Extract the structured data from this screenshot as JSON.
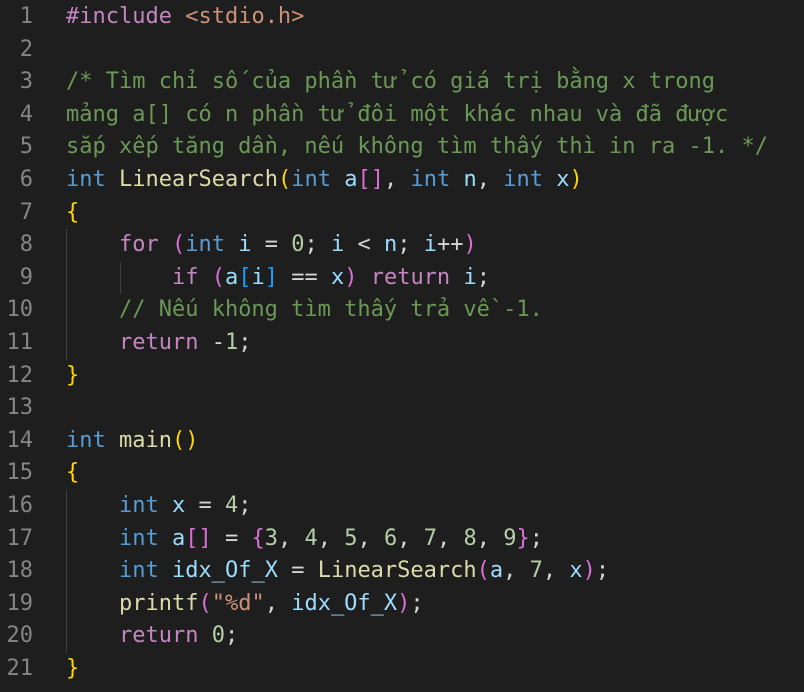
{
  "colors": {
    "background": "#1e1e1e",
    "line_number": "#858585",
    "default": "#d4d4d4",
    "keyword_control": "#c586c0",
    "keyword_type": "#569cd6",
    "function": "#dcdcaa",
    "variable": "#9cdcfe",
    "number": "#b5cea8",
    "string": "#ce9178",
    "comment": "#6a9955",
    "bracket_gold": "#ffd700",
    "bracket_pink": "#da70d6",
    "bracket_blue": "#179fff"
  },
  "editor": {
    "lines": [
      {
        "n": "1",
        "tokens": [
          [
            "#include ",
            "keyword_control"
          ],
          [
            "<stdio.h>",
            "string"
          ]
        ]
      },
      {
        "n": "2",
        "tokens": []
      },
      {
        "n": "3",
        "tokens": [
          [
            "/* Tìm chỉ số của phần tử có giá trị bằng x trong",
            "comment"
          ]
        ]
      },
      {
        "n": "4",
        "tokens": [
          [
            "mảng a[] có n phần tử đôi một khác nhau và đã được",
            "comment"
          ]
        ]
      },
      {
        "n": "5",
        "tokens": [
          [
            "sắp xếp tăng dần, nếu không tìm thấy thì in ra -1. */",
            "comment"
          ]
        ]
      },
      {
        "n": "6",
        "tokens": [
          [
            "int",
            "keyword_type"
          ],
          [
            " ",
            "default"
          ],
          [
            "LinearSearch",
            "function"
          ],
          [
            "(",
            "bracket_gold"
          ],
          [
            "int",
            "keyword_type"
          ],
          [
            " ",
            "default"
          ],
          [
            "a",
            "variable"
          ],
          [
            "[]",
            "bracket_pink"
          ],
          [
            ", ",
            "default"
          ],
          [
            "int",
            "keyword_type"
          ],
          [
            " ",
            "default"
          ],
          [
            "n",
            "variable"
          ],
          [
            ", ",
            "default"
          ],
          [
            "int",
            "keyword_type"
          ],
          [
            " ",
            "default"
          ],
          [
            "x",
            "variable"
          ],
          [
            ")",
            "bracket_gold"
          ]
        ]
      },
      {
        "n": "7",
        "tokens": [
          [
            "{",
            "bracket_gold"
          ]
        ]
      },
      {
        "n": "8",
        "tokens": [
          [
            "    ",
            "default"
          ],
          [
            "for",
            "keyword_control"
          ],
          [
            " ",
            "default"
          ],
          [
            "(",
            "bracket_pink"
          ],
          [
            "int",
            "keyword_type"
          ],
          [
            " ",
            "default"
          ],
          [
            "i",
            "variable"
          ],
          [
            " = ",
            "default"
          ],
          [
            "0",
            "number"
          ],
          [
            "; ",
            "default"
          ],
          [
            "i",
            "variable"
          ],
          [
            " < ",
            "default"
          ],
          [
            "n",
            "variable"
          ],
          [
            "; ",
            "default"
          ],
          [
            "i",
            "variable"
          ],
          [
            "++",
            "default"
          ],
          [
            ")",
            "bracket_pink"
          ]
        ]
      },
      {
        "n": "9",
        "tokens": [
          [
            "        ",
            "default"
          ],
          [
            "if",
            "keyword_control"
          ],
          [
            " ",
            "default"
          ],
          [
            "(",
            "bracket_pink"
          ],
          [
            "a",
            "variable"
          ],
          [
            "[",
            "bracket_blue"
          ],
          [
            "i",
            "variable"
          ],
          [
            "]",
            "bracket_blue"
          ],
          [
            " == ",
            "default"
          ],
          [
            "x",
            "variable"
          ],
          [
            ")",
            "bracket_pink"
          ],
          [
            " ",
            "default"
          ],
          [
            "return",
            "keyword_control"
          ],
          [
            " ",
            "default"
          ],
          [
            "i",
            "variable"
          ],
          [
            ";",
            "default"
          ]
        ]
      },
      {
        "n": "10",
        "tokens": [
          [
            "    ",
            "default"
          ],
          [
            "// Nếu không tìm thấy trả về -1.",
            "comment"
          ]
        ]
      },
      {
        "n": "11",
        "tokens": [
          [
            "    ",
            "default"
          ],
          [
            "return",
            "keyword_control"
          ],
          [
            " -",
            "default"
          ],
          [
            "1",
            "number"
          ],
          [
            ";",
            "default"
          ]
        ]
      },
      {
        "n": "12",
        "tokens": [
          [
            "}",
            "bracket_gold"
          ]
        ]
      },
      {
        "n": "13",
        "tokens": []
      },
      {
        "n": "14",
        "tokens": [
          [
            "int",
            "keyword_type"
          ],
          [
            " ",
            "default"
          ],
          [
            "main",
            "function"
          ],
          [
            "()",
            "bracket_gold"
          ]
        ]
      },
      {
        "n": "15",
        "tokens": [
          [
            "{",
            "bracket_gold"
          ]
        ]
      },
      {
        "n": "16",
        "tokens": [
          [
            "    ",
            "default"
          ],
          [
            "int",
            "keyword_type"
          ],
          [
            " ",
            "default"
          ],
          [
            "x",
            "variable"
          ],
          [
            " = ",
            "default"
          ],
          [
            "4",
            "number"
          ],
          [
            ";",
            "default"
          ]
        ]
      },
      {
        "n": "17",
        "tokens": [
          [
            "    ",
            "default"
          ],
          [
            "int",
            "keyword_type"
          ],
          [
            " ",
            "default"
          ],
          [
            "a",
            "variable"
          ],
          [
            "[]",
            "bracket_pink"
          ],
          [
            " = ",
            "default"
          ],
          [
            "{",
            "bracket_pink"
          ],
          [
            "3",
            "number"
          ],
          [
            ", ",
            "default"
          ],
          [
            "4",
            "number"
          ],
          [
            ", ",
            "default"
          ],
          [
            "5",
            "number"
          ],
          [
            ", ",
            "default"
          ],
          [
            "6",
            "number"
          ],
          [
            ", ",
            "default"
          ],
          [
            "7",
            "number"
          ],
          [
            ", ",
            "default"
          ],
          [
            "8",
            "number"
          ],
          [
            ", ",
            "default"
          ],
          [
            "9",
            "number"
          ],
          [
            "}",
            "bracket_pink"
          ],
          [
            ";",
            "default"
          ]
        ]
      },
      {
        "n": "18",
        "tokens": [
          [
            "    ",
            "default"
          ],
          [
            "int",
            "keyword_type"
          ],
          [
            " ",
            "default"
          ],
          [
            "idx_Of_X",
            "variable"
          ],
          [
            " = ",
            "default"
          ],
          [
            "LinearSearch",
            "function"
          ],
          [
            "(",
            "bracket_pink"
          ],
          [
            "a",
            "variable"
          ],
          [
            ", ",
            "default"
          ],
          [
            "7",
            "number"
          ],
          [
            ", ",
            "default"
          ],
          [
            "x",
            "variable"
          ],
          [
            ")",
            "bracket_pink"
          ],
          [
            ";",
            "default"
          ]
        ]
      },
      {
        "n": "19",
        "tokens": [
          [
            "    ",
            "default"
          ],
          [
            "printf",
            "function"
          ],
          [
            "(",
            "bracket_pink"
          ],
          [
            "\"%d\"",
            "string"
          ],
          [
            ", ",
            "default"
          ],
          [
            "idx_Of_X",
            "variable"
          ],
          [
            ")",
            "bracket_pink"
          ],
          [
            ";",
            "default"
          ]
        ]
      },
      {
        "n": "20",
        "tokens": [
          [
            "    ",
            "default"
          ],
          [
            "return",
            "keyword_control"
          ],
          [
            " ",
            "default"
          ],
          [
            "0",
            "number"
          ],
          [
            ";",
            "default"
          ]
        ]
      },
      {
        "n": "21",
        "tokens": [
          [
            "}",
            "bracket_gold"
          ]
        ]
      }
    ]
  }
}
